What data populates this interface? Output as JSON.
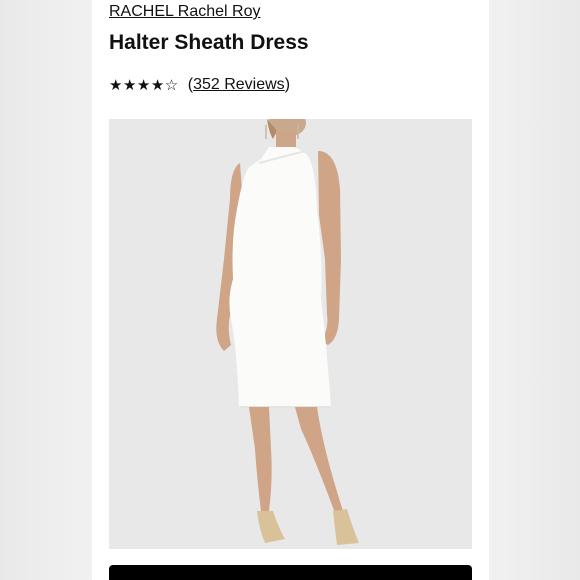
{
  "product": {
    "brand": "RACHEL Rachel Roy",
    "title": "Halter Sheath Dress",
    "rating": {
      "stars_text": "★★★★☆",
      "value": 4,
      "max": 5,
      "reviews_count_text": "352 Reviews"
    },
    "image": {
      "icon": "product-photo",
      "background_color": "#e8e8e8",
      "dress_color": "#fbfbf9"
    }
  },
  "cta": {
    "color": "#000000"
  }
}
